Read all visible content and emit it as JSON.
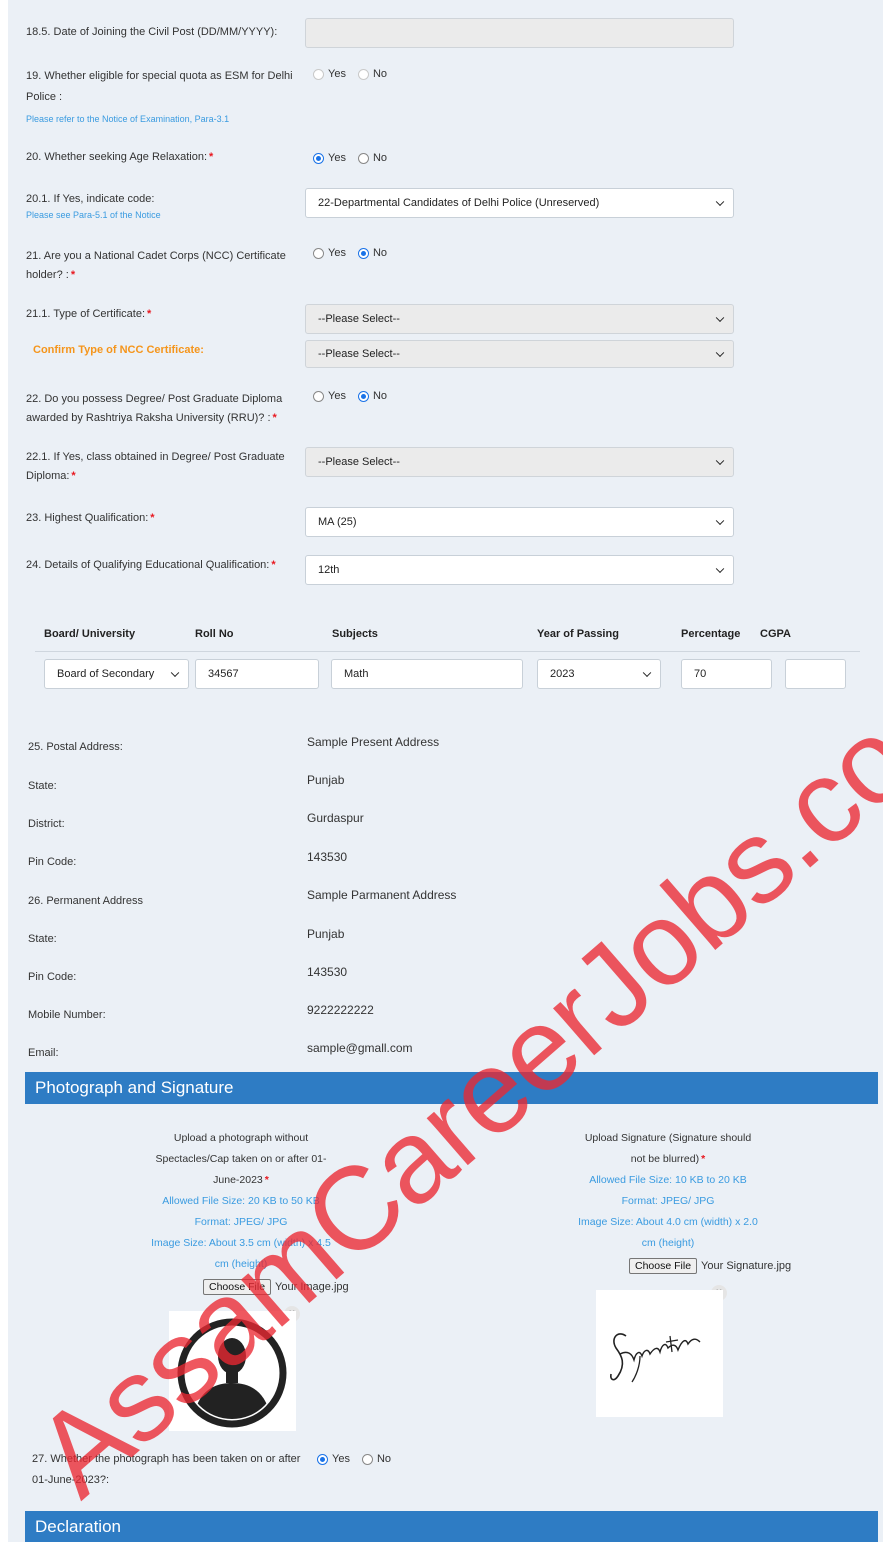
{
  "form": {
    "q18_5": {
      "label": "18.5. Date of Joining the Civil Post (DD/MM/YYYY):",
      "value": ""
    },
    "q19": {
      "label_line1": "19. Whether eligible for special quota as ESM for Delhi",
      "label_line2": "Police :",
      "hint": "Please refer to the Notice of Examination, Para-3.1",
      "options": [
        "Yes",
        "No"
      ],
      "selected": null
    },
    "q20": {
      "label": "20. Whether seeking Age Relaxation:",
      "required": "*",
      "options": [
        "Yes",
        "No"
      ],
      "selected": "Yes"
    },
    "q20_1": {
      "label": "20.1. If Yes, indicate code:",
      "hint": "Please see Para-5.1 of the Notice",
      "value": "22-Departmental Candidates of Delhi Police (Unreserved)"
    },
    "q21": {
      "label_line1": "21. Are you a National Cadet Corps (NCC) Certificate",
      "label_line2": "holder? :",
      "required": "*",
      "options": [
        "Yes",
        "No"
      ],
      "selected": "No"
    },
    "q21_1": {
      "label": "21.1. Type of Certificate:",
      "required": "*",
      "value": "--Please Select--"
    },
    "confirm_ncc": {
      "label": "Confirm Type of NCC Certificate:",
      "value": "--Please Select--"
    },
    "q22": {
      "label_line1": "22. Do you possess Degree/ Post Graduate Diploma",
      "label_line2": "awarded by Rashtriya Raksha University (RRU)? :",
      "required": "*",
      "options": [
        "Yes",
        "No"
      ],
      "selected": "No"
    },
    "q22_1": {
      "label_line1": "22.1. If Yes, class obtained in Degree/ Post Graduate",
      "label_line2": "Diploma:",
      "required": "*",
      "value": "--Please Select--"
    },
    "q23": {
      "label": "23. Highest Qualification:",
      "required": "*",
      "value": "MA (25)"
    },
    "q24": {
      "label": "24. Details of Qualifying Educational Qualification:",
      "required": "*",
      "value": "12th"
    }
  },
  "edu_table": {
    "headers": [
      "Board/ University",
      "Roll No",
      "Subjects",
      "Year of Passing",
      "Percentage",
      "CGPA"
    ],
    "row": {
      "board": "Board of Secondary",
      "roll": "34567",
      "subjects": "Math",
      "year": "2023",
      "percentage": "70",
      "cgpa": ""
    }
  },
  "address": [
    {
      "label": "25. Postal Address:",
      "value": "Sample Present Address"
    },
    {
      "label": "State:",
      "value": "Punjab"
    },
    {
      "label": "District:",
      "value": "Gurdaspur"
    },
    {
      "label": "Pin Code:",
      "value": "143530"
    },
    {
      "label": "26. Permanent Address",
      "value": "Sample Parmanent Address"
    },
    {
      "label": "State:",
      "value": "Punjab"
    },
    {
      "label": "Pin Code:",
      "value": "143530"
    },
    {
      "label": "Mobile Number:",
      "value": "9222222222"
    },
    {
      "label": "Email:",
      "value": "sample@gmall.com"
    }
  ],
  "photo_section": {
    "title": "Photograph and Signature",
    "photo": {
      "line1": "Upload a photograph without",
      "line2": "Spectacles/Cap taken on or after 01-",
      "line3": "June-2023",
      "required": "*",
      "size": "Allowed File Size: 20 KB to 50 KB",
      "format": "Format: JPEG/ JPG",
      "dims1": "Image Size: About 3.5 cm (width) x 4.5",
      "dims2": "cm (height)",
      "button": "Choose File",
      "file": "Your Image.jpg",
      "close": "×",
      "icon": "person-silhouette-icon"
    },
    "signature": {
      "line1": "Upload Signature (Signature should",
      "line2": "not be blurred)",
      "required": "*",
      "size": "Allowed File Size: 10 KB to 20 KB",
      "format": "Format: JPEG/ JPG",
      "dims1": "Image Size: About 4.0 cm (width) x 2.0",
      "dims2": "cm (height)",
      "button": "Choose File",
      "file": "Your Signature.jpg",
      "close": "×",
      "signature_text": "Signature"
    }
  },
  "q27": {
    "label_line1": "27. Whether the photograph has been taken on or after",
    "label_line2": "01-June-2023?:",
    "options": [
      "Yes",
      "No"
    ],
    "selected": "Yes"
  },
  "declaration": {
    "title": "Declaration"
  },
  "watermark": "AssamCareerJobs.com",
  "colors": {
    "section_bar": "#2e7cc4",
    "hint": "#3a9be0",
    "required": "#e8171f",
    "orange": "#f5951b",
    "page_bg": "#ebf0f6"
  }
}
